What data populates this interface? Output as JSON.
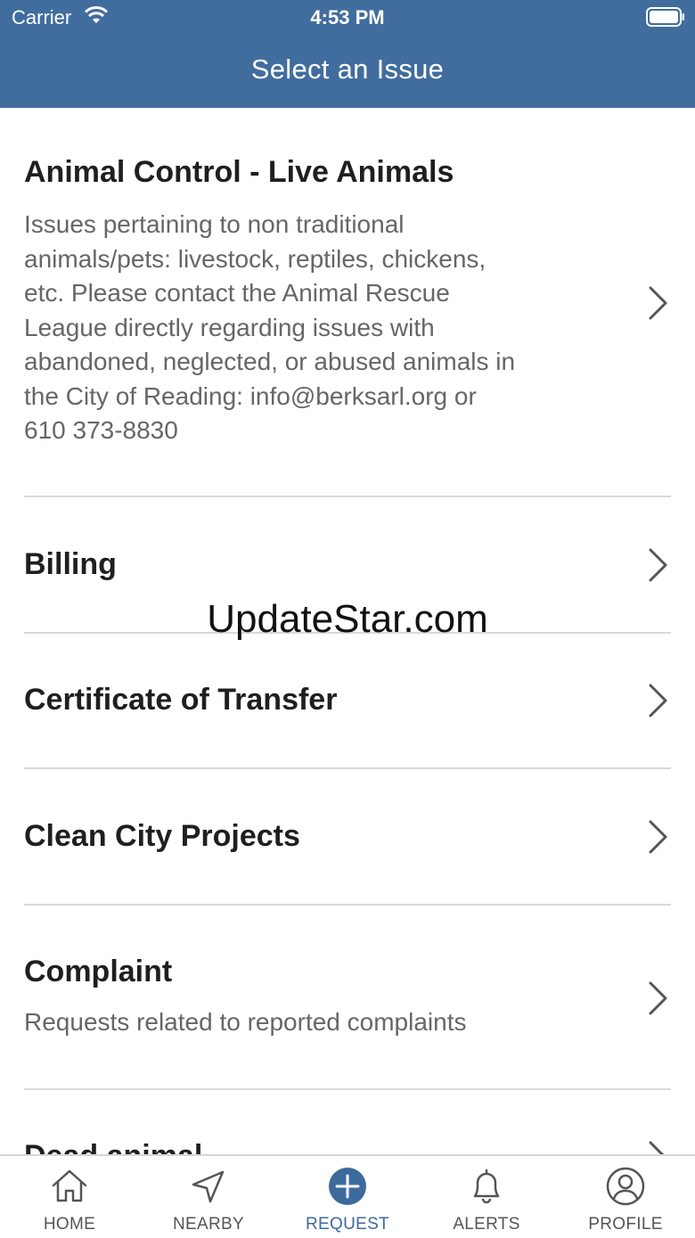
{
  "status_bar": {
    "carrier": "Carrier",
    "time": "4:53 PM"
  },
  "nav": {
    "title": "Select an Issue"
  },
  "issues": [
    {
      "title": "Animal Control - Live Animals",
      "description": "Issues pertaining to non traditional animals/pets: livestock, reptiles, chickens, etc.  Please contact the Animal Rescue League directly regarding issues with abandoned, neglected, or abused animals in the City of Reading:  info@berksarl.org or 610 373-8830"
    },
    {
      "title": "Billing",
      "description": ""
    },
    {
      "title": "Certificate of Transfer",
      "description": ""
    },
    {
      "title": "Clean City Projects",
      "description": ""
    },
    {
      "title": "Complaint",
      "description": "Requests related to reported complaints"
    },
    {
      "title": "Dead animal",
      "description": ""
    }
  ],
  "watermark": "UpdateStar.com",
  "tabs": [
    {
      "label": "HOME",
      "icon": "home-icon",
      "active": false
    },
    {
      "label": "NEARBY",
      "icon": "navigation-arrow-icon",
      "active": false
    },
    {
      "label": "REQUEST",
      "icon": "plus-circle-icon",
      "active": true
    },
    {
      "label": "ALERTS",
      "icon": "bell-icon",
      "active": false
    },
    {
      "label": "PROFILE",
      "icon": "user-circle-icon",
      "active": false
    }
  ],
  "colors": {
    "header": "#416d9e",
    "accent": "#3d6a9c",
    "divider": "#d9d9d9"
  }
}
